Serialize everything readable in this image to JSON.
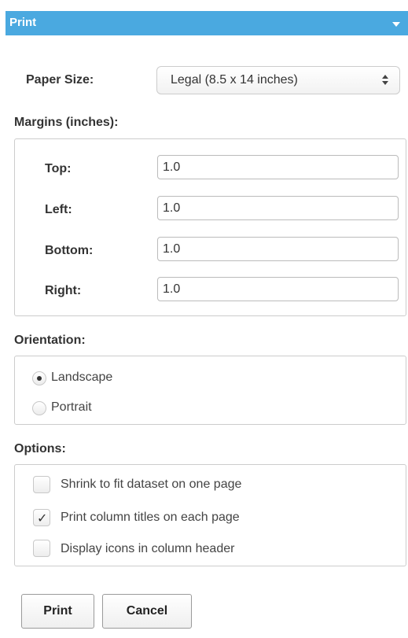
{
  "header": {
    "title": "Print",
    "collapse_icon": "caret-down-icon",
    "background_color": "#4aa9e0"
  },
  "paper_size": {
    "label": "Paper Size:",
    "selected": "Legal (8.5 x 14 inches)",
    "icon": "select-arrows-icon"
  },
  "margins": {
    "heading": "Margins (inches):",
    "top": {
      "label": "Top:",
      "value": "1.0"
    },
    "left": {
      "label": "Left:",
      "value": "1.0"
    },
    "bottom": {
      "label": "Bottom:",
      "value": "1.0"
    },
    "right": {
      "label": "Right:",
      "value": "1.0"
    }
  },
  "orientation": {
    "heading": "Orientation:",
    "selected": "Landscape",
    "options": [
      {
        "label": "Landscape",
        "checked": true
      },
      {
        "label": "Portrait",
        "checked": false
      }
    ]
  },
  "options": {
    "heading": "Options:",
    "items": [
      {
        "label": "Shrink to fit dataset on one page",
        "checked": false
      },
      {
        "label": "Print column titles on each page",
        "checked": true
      },
      {
        "label": "Display icons in column header",
        "checked": false
      }
    ],
    "check_glyph": "✓"
  },
  "buttons": {
    "print": "Print",
    "cancel": "Cancel"
  }
}
